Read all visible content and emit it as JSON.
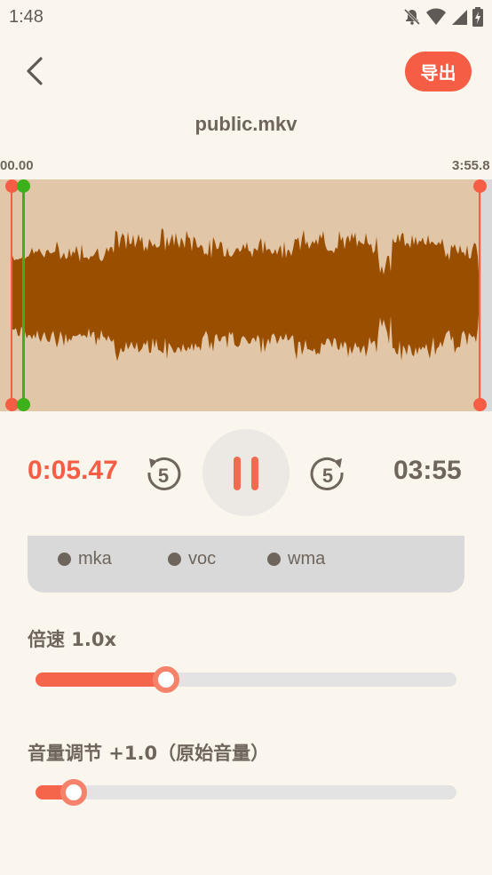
{
  "status": {
    "time": "1:48"
  },
  "header": {
    "export_label": "导出",
    "file_name": "public.mkv"
  },
  "waveform": {
    "start_time": "00.00",
    "end_time": "3:55.8"
  },
  "player": {
    "current_time": "0:05.47",
    "total_time": "03:55",
    "skip_seconds": "5"
  },
  "formats": [
    {
      "label": "mka"
    },
    {
      "label": "voc"
    },
    {
      "label": "wma"
    }
  ],
  "speed": {
    "label": "倍速 1.0x",
    "level": 0.31
  },
  "volume": {
    "label": "音量调节  +1.0（原始音量）",
    "level": 0.09
  },
  "colors": {
    "accent": "#f55d45",
    "wave": "#9a4e00",
    "wave_bg": "#e2c6a8",
    "start_handle": "#3db11b",
    "end_handle": "#f55d45"
  }
}
